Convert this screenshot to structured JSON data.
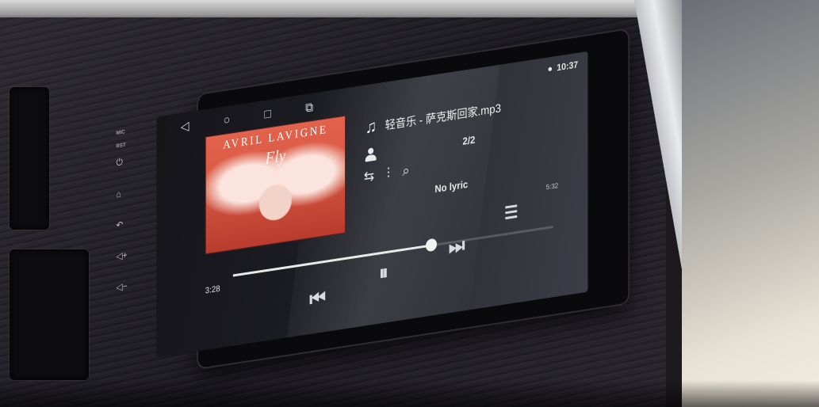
{
  "device": {
    "hardware": {
      "mic_label": "MIC",
      "rst_label": "RST",
      "buttons": [
        "⏻",
        "⌂",
        "↶",
        "◁+",
        "◁−"
      ]
    }
  },
  "screen": {
    "status": {
      "time": "10:37",
      "location_icon": "location-pin-icon"
    },
    "navbar": [
      "◁",
      "○",
      "□",
      "⧉"
    ],
    "album": {
      "title": "AVRIL LAVIGNE",
      "subtitle": "Fly"
    },
    "track": {
      "title": "轻音乐 - 萨克斯回家.mp3",
      "count": "2/2",
      "lyric": "No lyric",
      "elapsed": "3:28",
      "duration": "5:32",
      "progress_fraction": 0.62
    },
    "icons": {
      "note": "music-note-icon",
      "person": "person-icon",
      "repeat": "repeat-icon",
      "equalizer": "equalizer-icon",
      "search": "search-icon"
    },
    "controls": {
      "prev": "⏮",
      "pause": "⏸",
      "next": "⏭",
      "list": "☰"
    }
  },
  "colors": {
    "screen_bg": "#1b1b22",
    "text": "#e9e9e9",
    "wood": "#221f26"
  }
}
